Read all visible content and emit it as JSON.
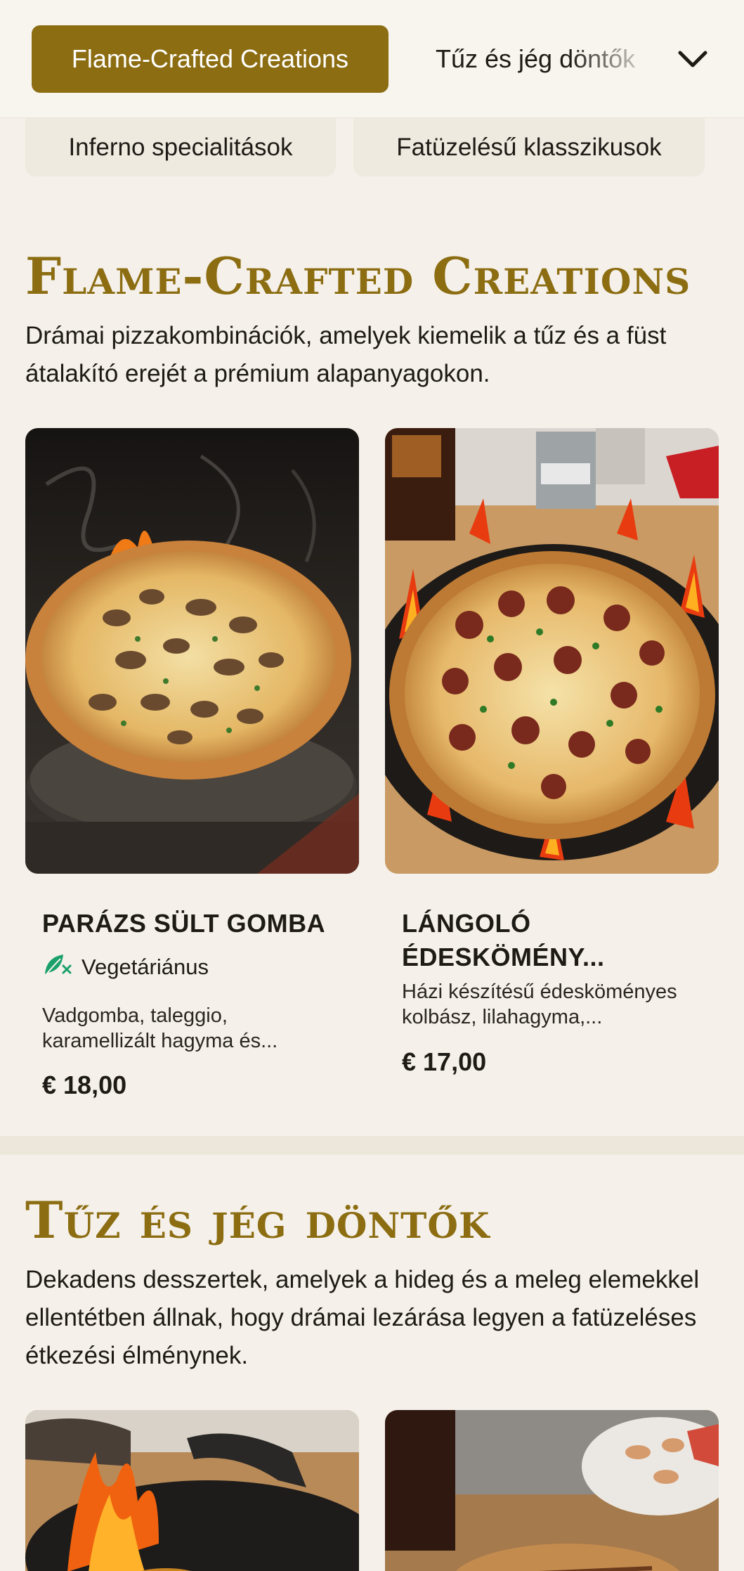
{
  "nav": {
    "active_label": "Flame-Crafted Creations",
    "next_label": "Tűz és jég döntők",
    "chevron_icon": "chevron-down-icon",
    "chips": [
      "Inferno specialitások",
      "Fatüzelésű klasszikusok"
    ]
  },
  "sections": [
    {
      "title": "Flame-Crafted Creations",
      "description": "Drámai pizzakombinációk, amelyek kiemelik a tűz és a füst átalakító erejét a prémium alapanyagokon.",
      "items": [
        {
          "name": "PARÁZS SÜLT GOMBA",
          "badge": "Vegetáriánus",
          "badge_icon": "leaf-icon",
          "description": "Vadgomba, taleggio, karamellizált hagyma és...",
          "price": "€ 18,00",
          "image_icon": "mushroom-pizza-photo"
        },
        {
          "name": "LÁNGOLÓ ÉDESKÖMÉNY...",
          "description": "Házi készítésű édesköményes kolbász, lilahagyma,...",
          "price": "€ 17,00",
          "image_icon": "sausage-pizza-photo"
        }
      ]
    },
    {
      "title": "Tűz és jég döntők",
      "description": "Dekadens desszertek, amelyek a hideg és a meleg elemekkel ellentétben állnak, hogy drámai lezárása legyen a fatüzeléses étkezési élménynek.",
      "items": [
        {
          "image_icon": "flambe-dessert-photo"
        },
        {
          "image_icon": "calzone-dessert-photo"
        }
      ]
    }
  ],
  "colors": {
    "accent": "#8c6d12",
    "background": "#f5f1ea",
    "veg_badge": "#1aa06b"
  }
}
